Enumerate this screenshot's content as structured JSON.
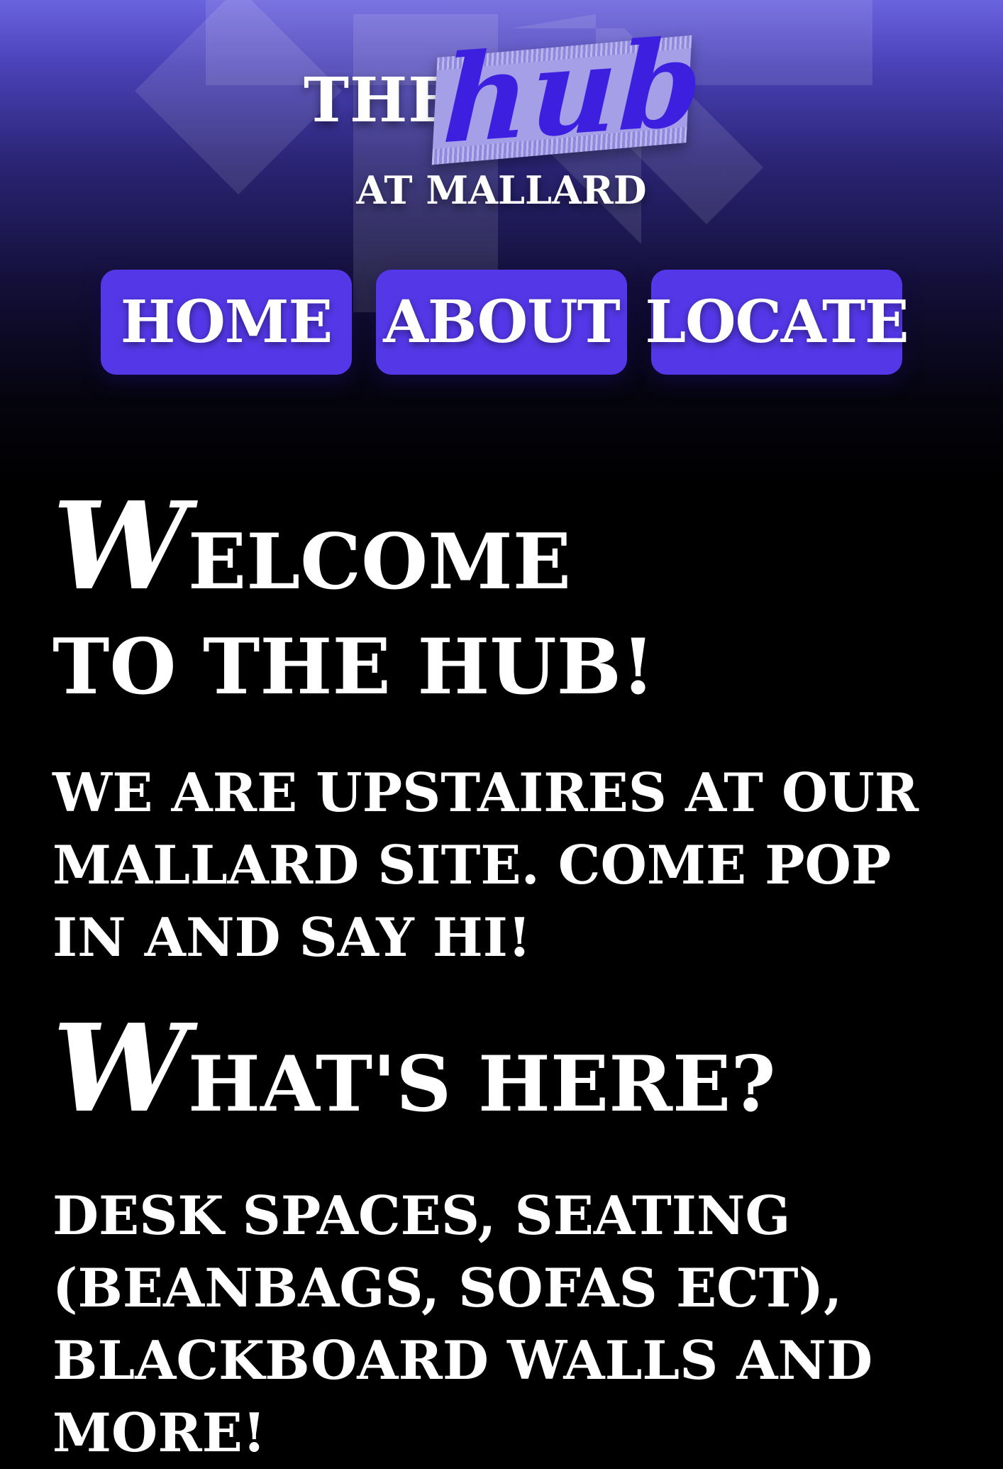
{
  "header": {
    "logo": {
      "prefix": "THE",
      "name": "hub",
      "subtitle": "AT MALLARD"
    },
    "colors": {
      "accent": "#5438e8",
      "hub_text": "#3d1fe0",
      "gradient_top": "#6a63df",
      "background": "#000000"
    }
  },
  "nav": {
    "items": [
      {
        "label": "HOME"
      },
      {
        "label": "ABOUT"
      },
      {
        "label": "LOCATE"
      }
    ]
  },
  "main": {
    "welcome": {
      "initial": "W",
      "rest": "ELCOME TO THE HUB!"
    },
    "intro_text": "WE ARE UPSTAIRES AT OUR MALLARD SITE. COME POP IN AND SAY HI!",
    "whats_here": {
      "initial": "W",
      "rest": "HAT'S HERE?"
    },
    "whats_here_text": "DESK SPACES, SEATING (BEANBAGS, SOFAS ECT), BLACKBOARD WALLS AND MORE!"
  }
}
